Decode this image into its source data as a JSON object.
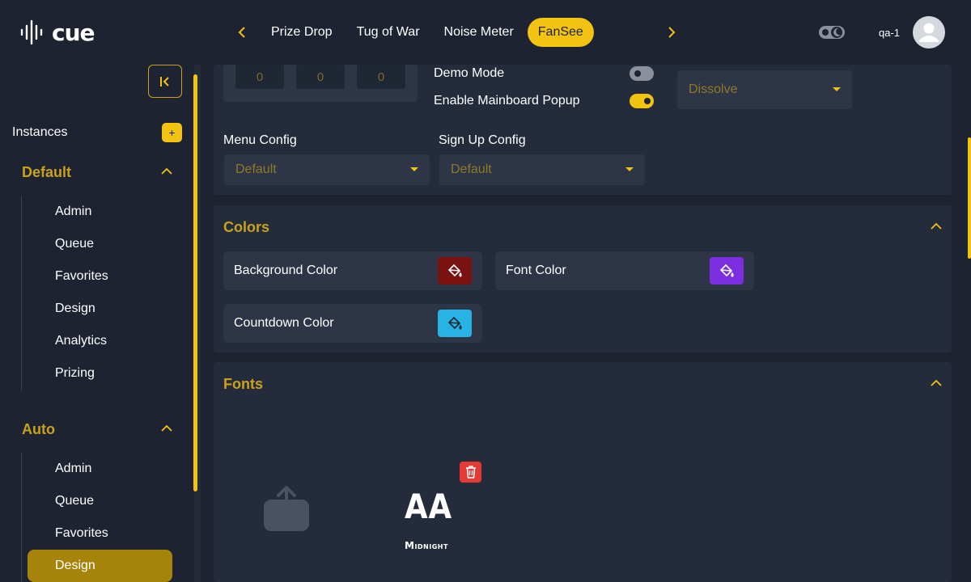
{
  "app": {
    "logo_text": "cue"
  },
  "nav": {
    "tabs": [
      {
        "label": "Prize Drop"
      },
      {
        "label": "Tug of War"
      },
      {
        "label": "Noise Meter"
      },
      {
        "label": "FanSee"
      }
    ],
    "active_tab": "FanSee"
  },
  "user": {
    "name": "qa-1"
  },
  "sidebar": {
    "instances_label": "Instances",
    "add_label": "+",
    "groups": [
      {
        "title": "Default",
        "items": [
          "Admin",
          "Queue",
          "Favorites",
          "Design",
          "Analytics",
          "Prizing"
        ]
      },
      {
        "title": "Auto",
        "items": [
          "Admin",
          "Queue",
          "Favorites",
          "Design"
        ],
        "active_item": "Design"
      }
    ]
  },
  "settings": {
    "mini_values": [
      "0",
      "0",
      "0"
    ],
    "demo_mode_label": "Demo Mode",
    "demo_mode_on": false,
    "mainboard_popup_label": "Enable Mainboard Popup",
    "mainboard_popup_on": true,
    "transition_value": "Dissolve",
    "menu_config_label": "Menu Config",
    "menu_config_value": "Default",
    "signup_config_label": "Sign Up Config",
    "signup_config_value": "Default"
  },
  "colors": {
    "title": "Colors",
    "items": [
      {
        "label": "Background Color",
        "color": "#7a1212"
      },
      {
        "label": "Font Color",
        "color": "#7b2fe0"
      },
      {
        "label": "Countdown Color",
        "color": "#27b3e3"
      }
    ]
  },
  "fonts": {
    "title": "Fonts",
    "preview_text": "AA",
    "font_name": "Midnight"
  },
  "theme": {
    "accent": "#f2c311",
    "bg": "#1d2330",
    "card": "#242c3b",
    "danger": "#e53935"
  }
}
